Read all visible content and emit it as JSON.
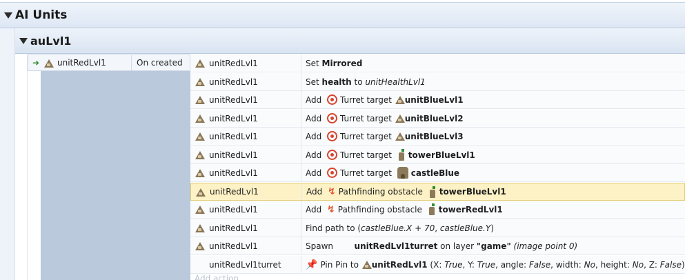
{
  "group": {
    "title": "AI Units"
  },
  "subgroup": {
    "title": "auLvl1"
  },
  "event": {
    "condition": {
      "object": "unitRedLvl1",
      "trigger": "On created"
    }
  },
  "actions": [
    {
      "object": "unitRedLvl1",
      "parts": [
        [
          "t",
          "Set "
        ],
        [
          "b",
          "Mirrored"
        ]
      ]
    },
    {
      "object": "unitRedLvl1",
      "parts": [
        [
          "t",
          "Set "
        ],
        [
          "b",
          "health"
        ],
        [
          "t",
          " to "
        ],
        [
          "i",
          "unitHealthLvl1"
        ]
      ]
    },
    {
      "object": "unitRedLvl1",
      "parts": [
        [
          "t",
          "Add "
        ],
        [
          "icon",
          "turret-icon"
        ],
        [
          "t",
          "Turret target "
        ],
        [
          "icon",
          "unit-icon"
        ],
        [
          "b",
          "unitBlueLvl1"
        ]
      ]
    },
    {
      "object": "unitRedLvl1",
      "parts": [
        [
          "t",
          "Add "
        ],
        [
          "icon",
          "turret-icon"
        ],
        [
          "t",
          "Turret target "
        ],
        [
          "icon",
          "unit-icon"
        ],
        [
          "b",
          "unitBlueLvl2"
        ]
      ]
    },
    {
      "object": "unitRedLvl1",
      "parts": [
        [
          "t",
          "Add "
        ],
        [
          "icon",
          "turret-icon"
        ],
        [
          "t",
          "Turret target "
        ],
        [
          "icon",
          "unit-icon"
        ],
        [
          "b",
          "unitBlueLvl3"
        ]
      ]
    },
    {
      "object": "unitRedLvl1",
      "parts": [
        [
          "t",
          "Add "
        ],
        [
          "icon",
          "turret-icon"
        ],
        [
          "t",
          "Turret target "
        ],
        [
          "icon",
          "tower-icon"
        ],
        [
          "b",
          "towerBlueLvl1"
        ]
      ]
    },
    {
      "object": "unitRedLvl1",
      "parts": [
        [
          "t",
          "Add "
        ],
        [
          "icon",
          "turret-icon"
        ],
        [
          "t",
          "Turret target "
        ],
        [
          "icon",
          "castle-icon"
        ],
        [
          "b",
          "castleBlue"
        ]
      ]
    },
    {
      "object": "unitRedLvl1",
      "selected": true,
      "parts": [
        [
          "t",
          "Add "
        ],
        [
          "icon",
          "path-icon"
        ],
        [
          "t",
          "Pathfinding obstacle "
        ],
        [
          "icon",
          "tower-icon"
        ],
        [
          "b",
          "towerBlueLvl1"
        ]
      ]
    },
    {
      "object": "unitRedLvl1",
      "parts": [
        [
          "t",
          "Add "
        ],
        [
          "icon",
          "path-icon"
        ],
        [
          "t",
          "Pathfinding obstacle "
        ],
        [
          "icon",
          "tower-icon"
        ],
        [
          "b",
          "towerRedLvl1"
        ]
      ]
    },
    {
      "object": "unitRedLvl1",
      "parts": [
        [
          "t",
          "Find path to ("
        ],
        [
          "i",
          "castleBlue.X + 70"
        ],
        [
          "t",
          ", "
        ],
        [
          "i",
          "castleBlue.Y"
        ],
        [
          "t",
          ")"
        ]
      ]
    },
    {
      "object": "unitRedLvl1",
      "parts": [
        [
          "t",
          "Spawn        "
        ],
        [
          "b",
          "unitRedLvl1turret"
        ],
        [
          "t",
          " on layer "
        ],
        [
          "b",
          "\"game\""
        ],
        [
          "t",
          " "
        ],
        [
          "i",
          "(image point 0)"
        ]
      ]
    },
    {
      "object": "unitRedLvl1turret",
      "noicon": true,
      "parts": [
        [
          "icon",
          "pin-icon"
        ],
        [
          "t",
          "Pin Pin to "
        ],
        [
          "icon",
          "unit-icon"
        ],
        [
          "b",
          "unitRedLvl1"
        ],
        [
          "t",
          " (X: "
        ],
        [
          "i",
          "True"
        ],
        [
          "t",
          ", Y: "
        ],
        [
          "i",
          "True"
        ],
        [
          "t",
          ", angle: "
        ],
        [
          "i",
          "False"
        ],
        [
          "t",
          ", width: "
        ],
        [
          "i",
          "No"
        ],
        [
          "t",
          ", height: "
        ],
        [
          "i",
          "No"
        ],
        [
          "t",
          ", Z: "
        ],
        [
          "i",
          "False"
        ],
        [
          "t",
          ")"
        ]
      ]
    }
  ],
  "add_action_label": "Add action"
}
